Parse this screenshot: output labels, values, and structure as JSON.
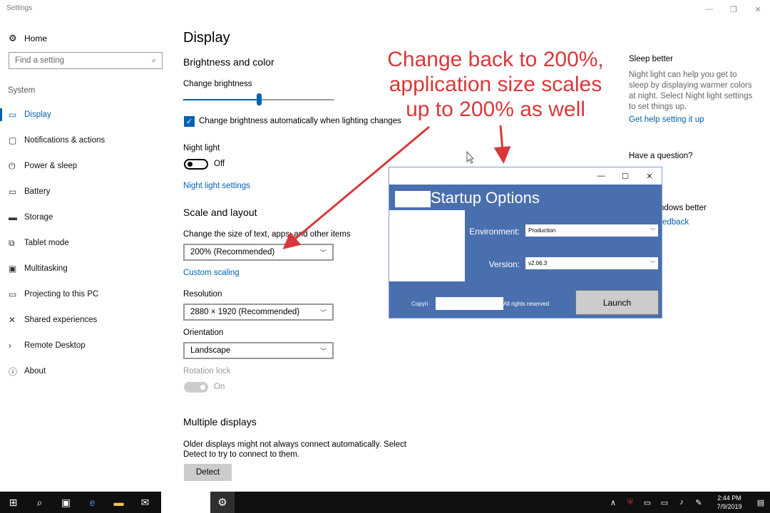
{
  "window": {
    "title": "Settings",
    "minimize": "—",
    "restore": "❐",
    "close": "✕"
  },
  "sidebar": {
    "home": {
      "icon": "gear-icon",
      "label": "Home"
    },
    "search": {
      "placeholder": "Find a setting",
      "icon": "search-icon"
    },
    "section": "System",
    "items": [
      {
        "label": "Display",
        "icon": "display-icon",
        "active": true
      },
      {
        "label": "Notifications & actions",
        "icon": "notifications-icon"
      },
      {
        "label": "Power & sleep",
        "icon": "power-icon"
      },
      {
        "label": "Battery",
        "icon": "battery-icon"
      },
      {
        "label": "Storage",
        "icon": "storage-icon"
      },
      {
        "label": "Tablet mode",
        "icon": "tablet-icon"
      },
      {
        "label": "Multitasking",
        "icon": "multitasking-icon"
      },
      {
        "label": "Projecting to this PC",
        "icon": "projecting-icon"
      },
      {
        "label": "Shared experiences",
        "icon": "shared-icon"
      },
      {
        "label": "Remote Desktop",
        "icon": "remote-icon"
      },
      {
        "label": "About",
        "icon": "info-icon"
      }
    ]
  },
  "main": {
    "title": "Display",
    "brightness": {
      "heading": "Brightness and color",
      "slider_label": "Change brightness",
      "slider_value": 0.5,
      "auto_label": "Change brightness automatically when lighting changes",
      "auto_checked": true
    },
    "night_light": {
      "label": "Night light",
      "state": "Off",
      "settings_link": "Night light settings"
    },
    "scale": {
      "heading": "Scale and layout",
      "size_label": "Change the size of text, apps, and other items",
      "size_value": "200% (Recommended)",
      "custom_link": "Custom scaling",
      "resolution_label": "Resolution",
      "resolution_value": "2880 × 1920 (Recommended)",
      "orientation_label": "Orientation",
      "orientation_value": "Landscape",
      "rotation_label": "Rotation lock",
      "rotation_state": "On"
    },
    "multiple": {
      "heading": "Multiple displays",
      "desc_line1": "Older displays might not always connect automatically. Select",
      "desc_line2": "Detect to try to connect to them.",
      "detect_button": "Detect"
    }
  },
  "right": {
    "sleep_heading": "Sleep better",
    "sleep_desc": "Night light can help you get to sleep by displaying warmer colors at night. Select Night light settings to set things up.",
    "sleep_link": "Get help setting it up",
    "question_heading": "Have a question?",
    "better_heading": "ndows better",
    "better_link": "edback"
  },
  "annotation": {
    "lines": [
      "Change back to 200%,",
      "application size scales",
      "up to 200% as well"
    ],
    "color": "#d9383a"
  },
  "startup": {
    "title": "Startup Options",
    "environment_label": "Environment:",
    "environment_value": "Production",
    "version_label": "Version:",
    "version_value": "v2.06.3",
    "copyright_prefix": "Copyri",
    "rights": "All rights reserved",
    "launch_button": "Launch",
    "minimize": "—",
    "maximize": "☐",
    "close": "✕"
  },
  "taskbar": {
    "icons": [
      "windows-start-icon",
      "search-icon",
      "task-view-icon",
      "edge-icon",
      "file-explorer-icon",
      "mail-icon"
    ],
    "active_app_icon": "settings-gear-icon",
    "tray": [
      "chevron-up-icon",
      "security-icon",
      "battery-icon",
      "network-icon",
      "volume-icon",
      "pen-icon"
    ],
    "time": "2:44 PM",
    "date": "7/9/2019",
    "notification_icon": "action-center-icon"
  }
}
